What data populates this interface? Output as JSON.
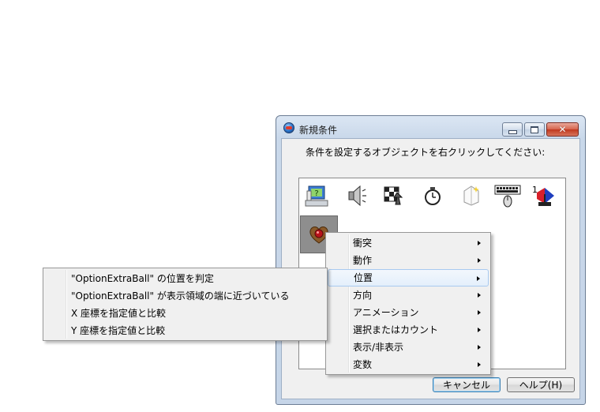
{
  "window": {
    "title": "新規条件",
    "instruction": "条件を設定するオブジェクトを右クリックしてください:",
    "controls": {
      "minimize": "minimize",
      "maximize": "maximize",
      "close": "✕"
    }
  },
  "objects": [
    {
      "name": "special-conditions-icon"
    },
    {
      "name": "sound-icon"
    },
    {
      "name": "storyboard-controls-icon"
    },
    {
      "name": "timer-icon"
    },
    {
      "name": "create-new-objects-icon"
    },
    {
      "name": "mouse-keyboard-icon"
    },
    {
      "name": "player-icon"
    },
    {
      "name": "option-extra-ball-icon",
      "selected": true
    }
  ],
  "buttons": {
    "cancel": "キャンセル",
    "help": "ヘルプ(H)"
  },
  "context_menu": {
    "items": [
      {
        "label": "衝突",
        "submenu": true
      },
      {
        "label": "動作",
        "submenu": true
      },
      {
        "label": "位置",
        "submenu": true,
        "highlighted": true
      },
      {
        "label": "方向",
        "submenu": true
      },
      {
        "label": "アニメーション",
        "submenu": true
      },
      {
        "label": "選択またはカウント",
        "submenu": true
      },
      {
        "label": "表示/非表示",
        "submenu": true
      },
      {
        "label": "変数",
        "submenu": true
      }
    ]
  },
  "submenu": {
    "items": [
      {
        "label": "\"OptionExtraBall\" の位置を判定"
      },
      {
        "label": "\"OptionExtraBall\" が表示領域の端に近づいている"
      },
      {
        "label": "X 座標を指定値と比較"
      },
      {
        "label": "Y 座標を指定値と比較"
      }
    ]
  }
}
